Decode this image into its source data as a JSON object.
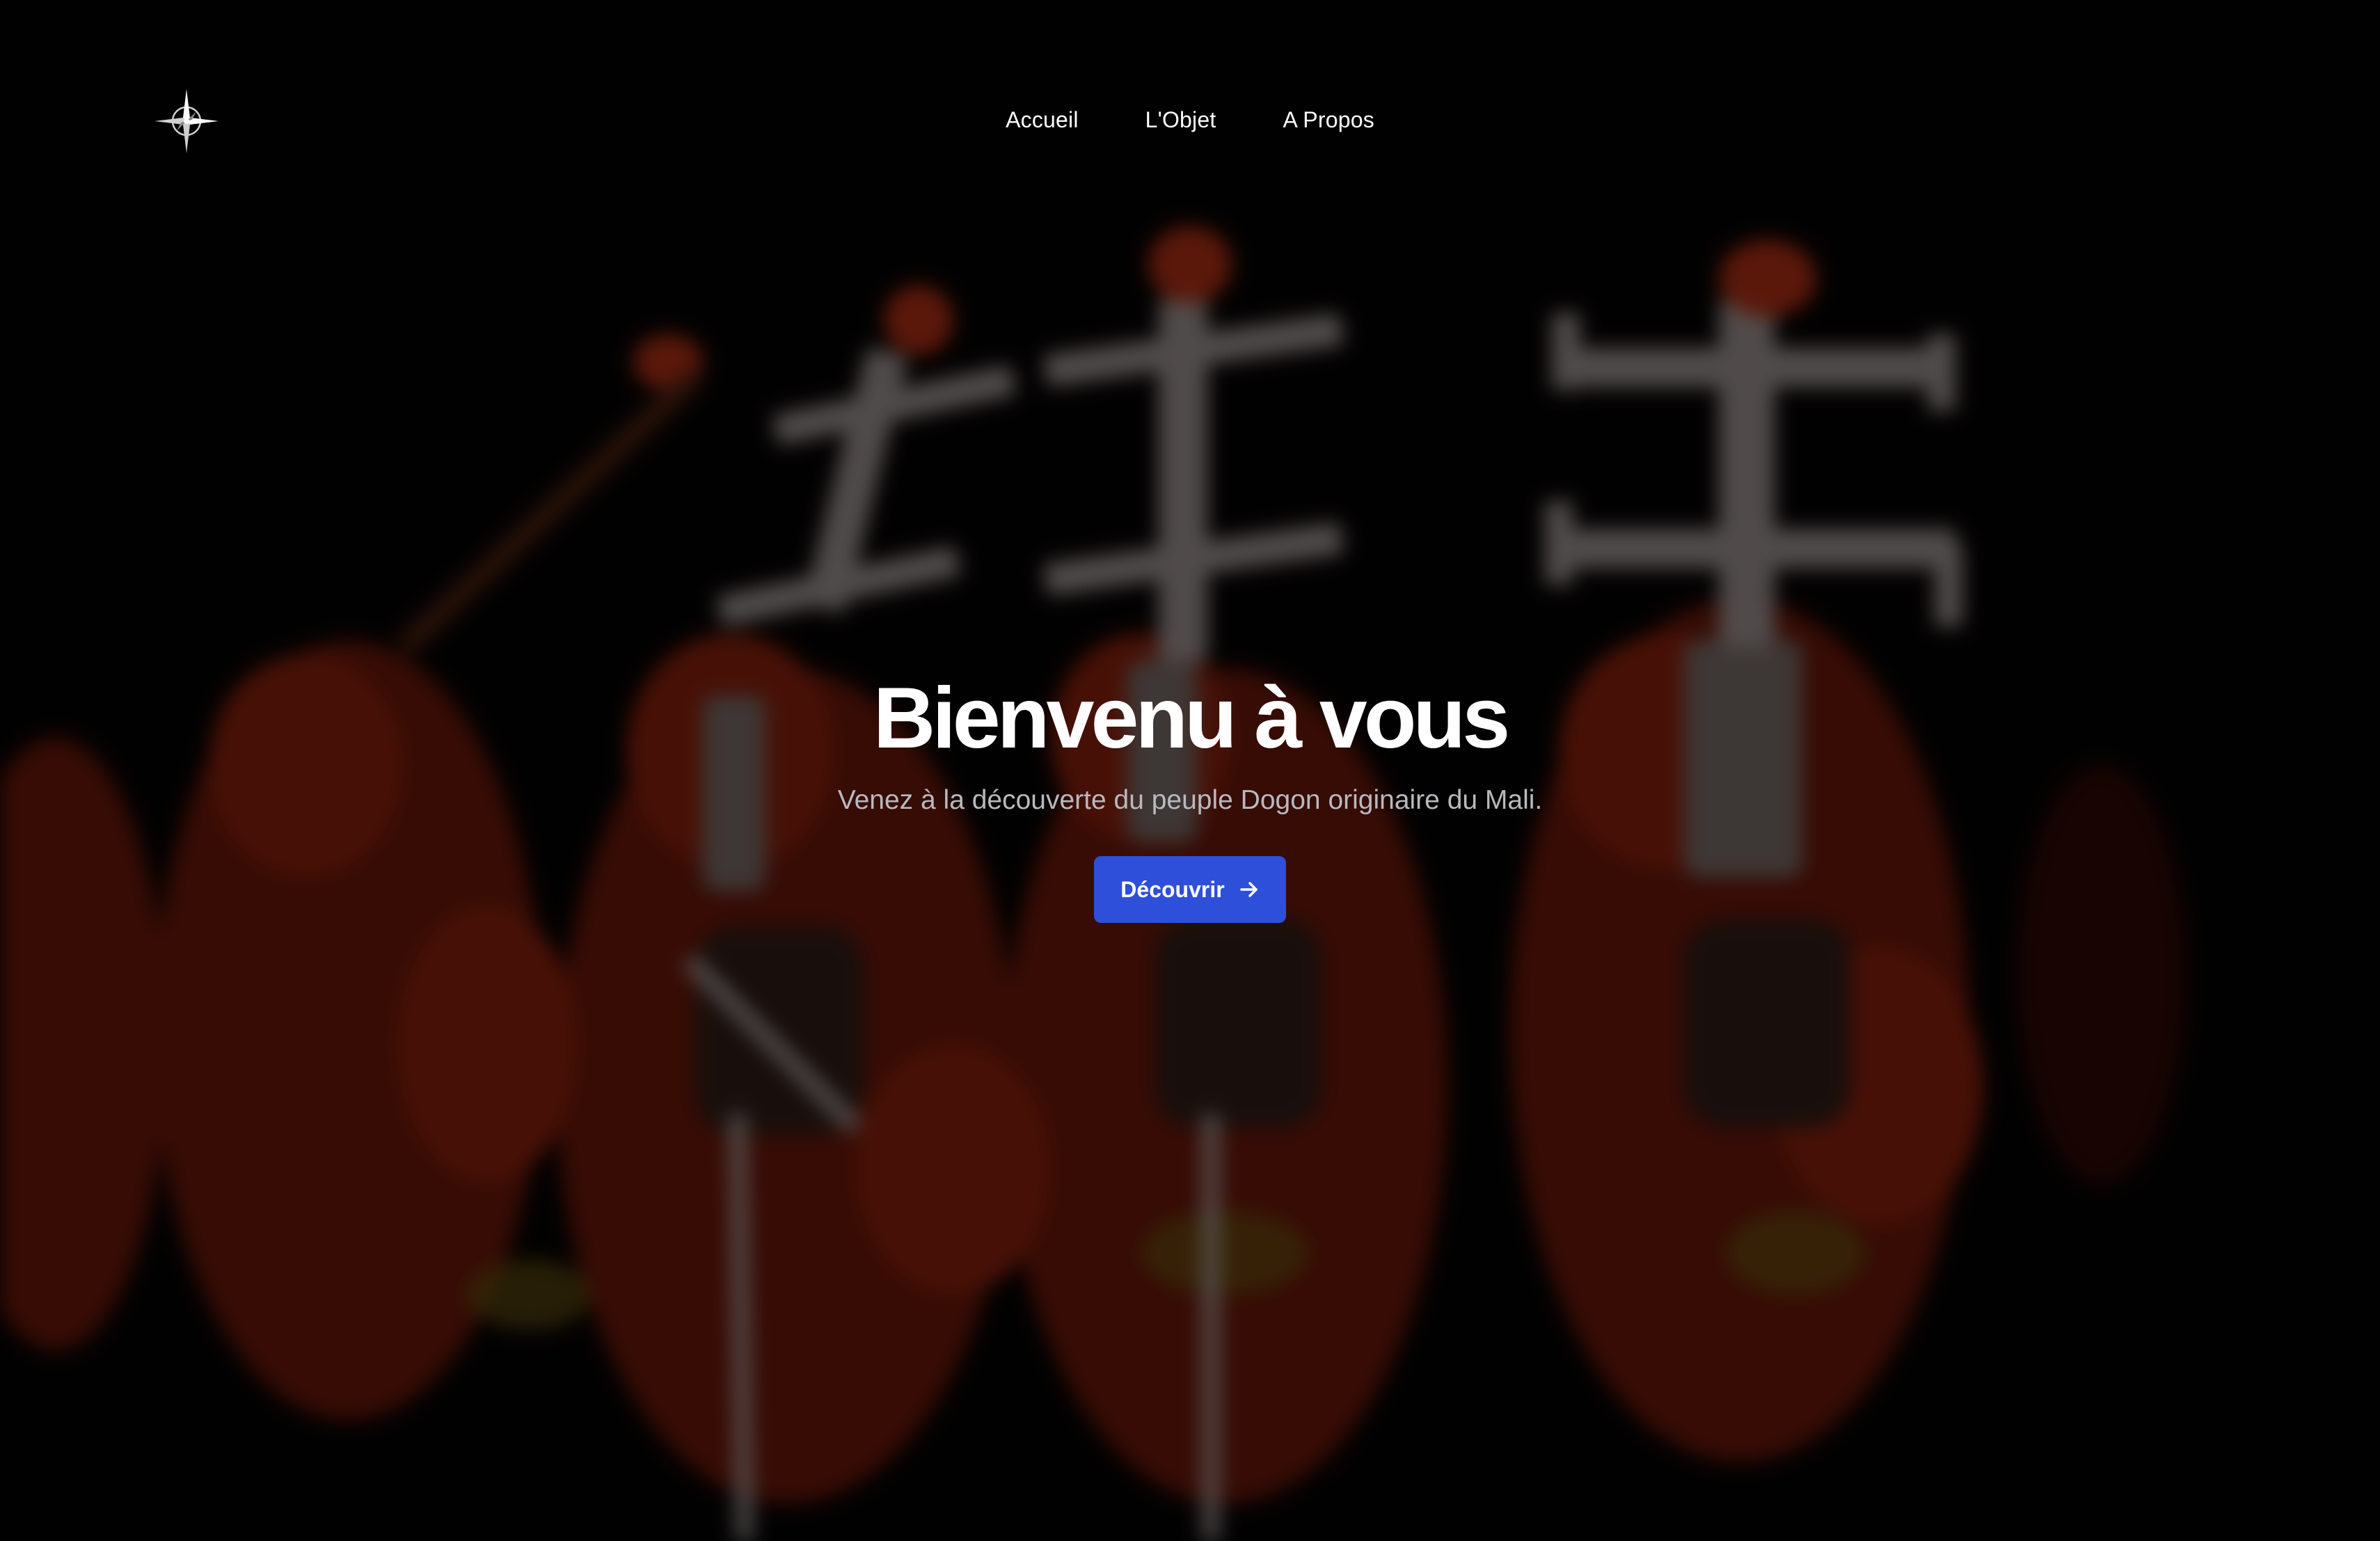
{
  "header": {
    "logo_icon": "compass-star-icon",
    "nav": [
      {
        "label": "Accueil"
      },
      {
        "label": "L'Objet"
      },
      {
        "label": "A Propos"
      }
    ]
  },
  "hero": {
    "title": "Bienvenu à vous",
    "subtitle": "Venez à la découverte du peuple Dogon originaire du Mali.",
    "cta_label": "Découvrir",
    "cta_icon": "arrow-right-icon",
    "background_image": "blurred-dogon-dancers-photo",
    "colors": {
      "accent": "#2e4fd9",
      "title": "#ffffff",
      "subtitle": "#b9b9be",
      "background": "#050303"
    }
  }
}
